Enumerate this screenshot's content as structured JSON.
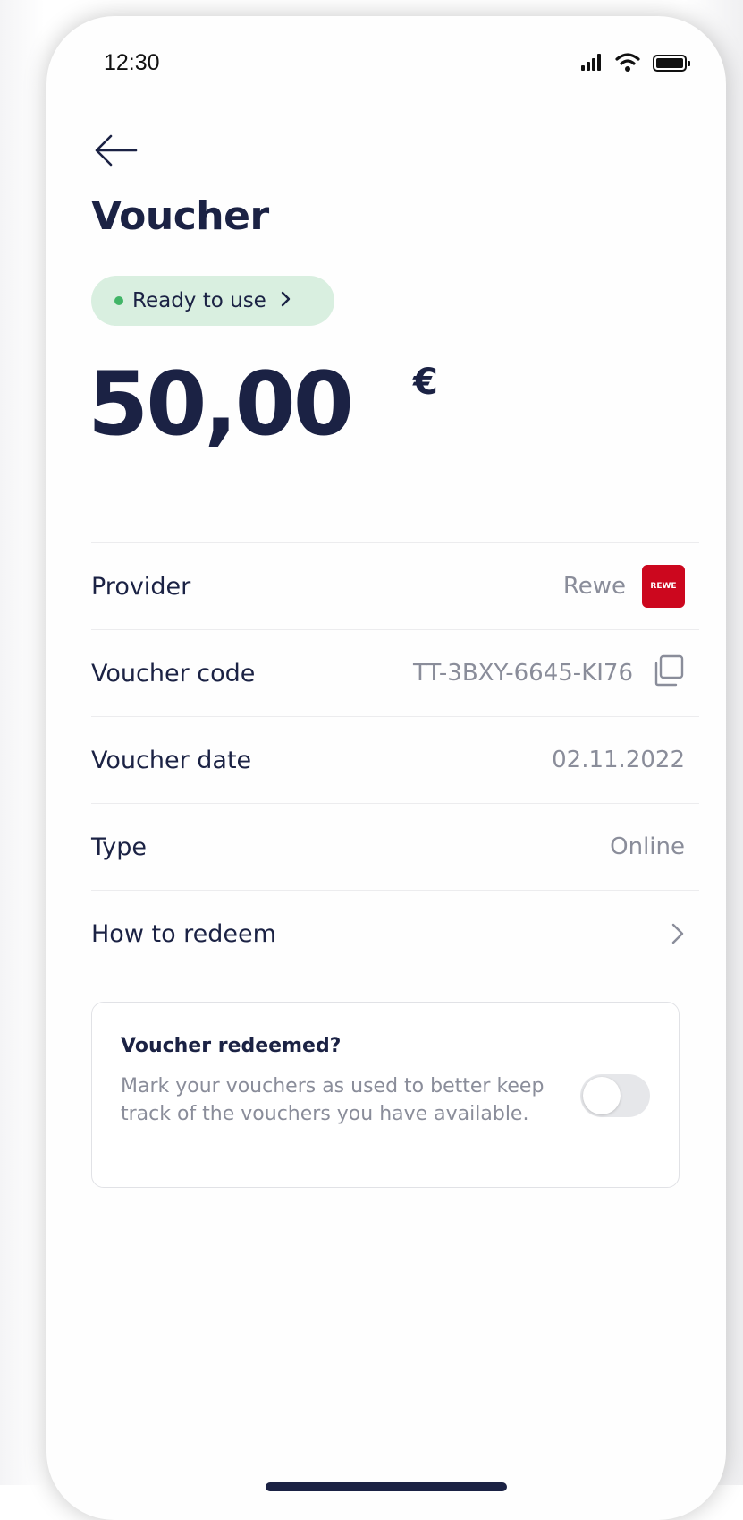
{
  "status_bar": {
    "time": "12:30",
    "icons": [
      "signal-icon",
      "wifi-icon",
      "battery-icon"
    ]
  },
  "header": {
    "back_icon": "arrow-left-icon",
    "title": "Voucher"
  },
  "status_pill": {
    "label": "Ready to use",
    "dot_color": "#41b567",
    "background": "#d9efe0"
  },
  "amount": {
    "value": "50,00",
    "currency": "€"
  },
  "details": {
    "provider": {
      "label": "Provider",
      "value": "Rewe",
      "logo_text": "REWE",
      "logo_color": "#cc071e"
    },
    "code": {
      "label": "Voucher code",
      "value": "TT-3BXY-6645-KI76"
    },
    "date": {
      "label": "Voucher date",
      "value": "02.11.2022"
    },
    "type": {
      "label": "Type",
      "value": "Online"
    },
    "redeem": {
      "label": "How to redeem"
    }
  },
  "redeem_card": {
    "title": "Voucher redeemed?",
    "description": "Mark your vouchers as used to better keep track of the vouchers you have available.",
    "toggle_on": false
  },
  "colors": {
    "primary_text": "#1b2244",
    "secondary_text": "#8a8d9a"
  }
}
